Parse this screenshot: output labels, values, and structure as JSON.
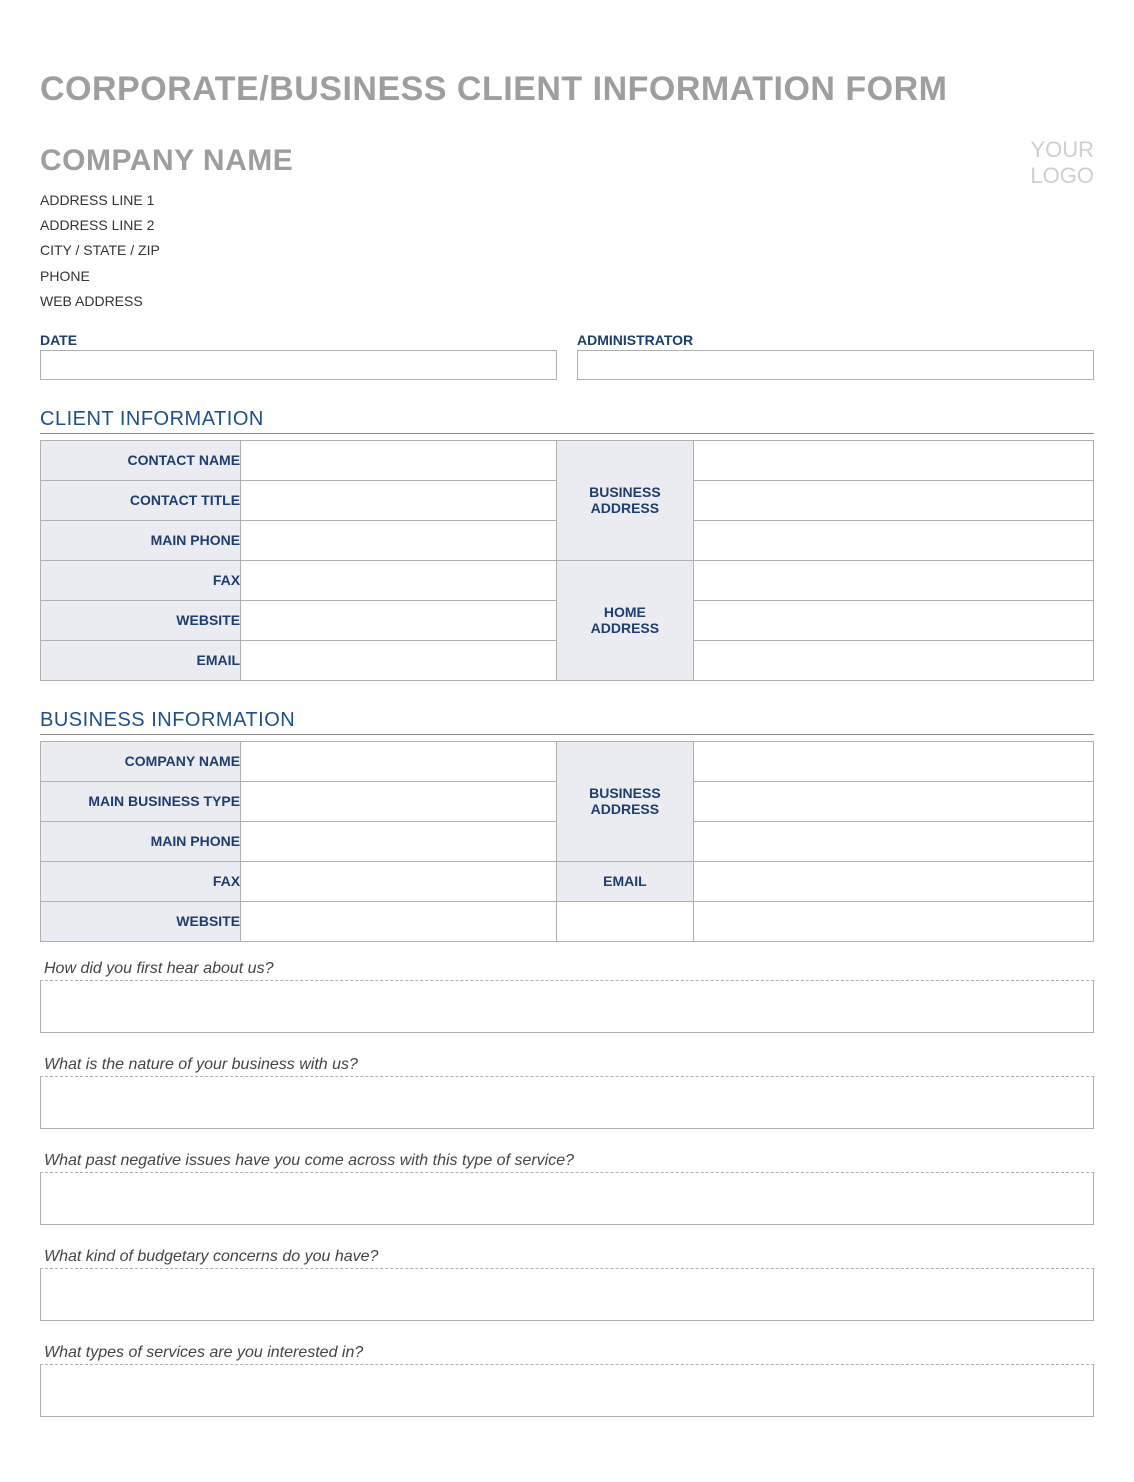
{
  "title": "CORPORATE/BUSINESS CLIENT INFORMATION FORM",
  "company": {
    "name": "COMPANY NAME",
    "address1": "ADDRESS LINE 1",
    "address2": "ADDRESS LINE 2",
    "csz": "CITY / STATE / ZIP",
    "phone": "PHONE",
    "web": "WEB ADDRESS",
    "logo": "YOUR\nLOGO"
  },
  "meta": {
    "date_label": "DATE",
    "date_value": "",
    "admin_label": "ADMINISTRATOR",
    "admin_value": ""
  },
  "sections": {
    "client": "CLIENT INFORMATION",
    "business": "BUSINESS INFORMATION"
  },
  "client": {
    "labels": {
      "contact_name": "CONTACT NAME",
      "contact_title": "CONTACT TITLE",
      "main_phone": "MAIN PHONE",
      "fax": "FAX",
      "website": "WEBSITE",
      "email": "EMAIL",
      "business_address": "BUSINESS\nADDRESS",
      "home_address": "HOME\nADDRESS"
    },
    "values": {
      "contact_name": "",
      "contact_title": "",
      "main_phone": "",
      "fax": "",
      "website": "",
      "email": "",
      "business_address_1": "",
      "business_address_2": "",
      "business_address_3": "",
      "home_address_1": "",
      "home_address_2": "",
      "home_address_3": ""
    }
  },
  "business": {
    "labels": {
      "company_name": "COMPANY NAME",
      "main_business_type": "MAIN BUSINESS TYPE",
      "main_phone": "MAIN PHONE",
      "fax": "FAX",
      "website": "WEBSITE",
      "business_address": "BUSINESS\nADDRESS",
      "email": "EMAIL"
    },
    "values": {
      "company_name": "",
      "main_business_type": "",
      "main_phone": "",
      "fax": "",
      "website": "",
      "business_address_1": "",
      "business_address_2": "",
      "business_address_3": "",
      "email": ""
    }
  },
  "questions": {
    "q1": "How did you first hear about us?",
    "q2": "What is the nature of your business with us?",
    "q3": "What past negative issues have you come across with this type of service?",
    "q4": "What kind of budgetary concerns do you have?",
    "q5": "What types of services are you interested in?",
    "a1": "",
    "a2": "",
    "a3": "",
    "a4": "",
    "a5": ""
  }
}
